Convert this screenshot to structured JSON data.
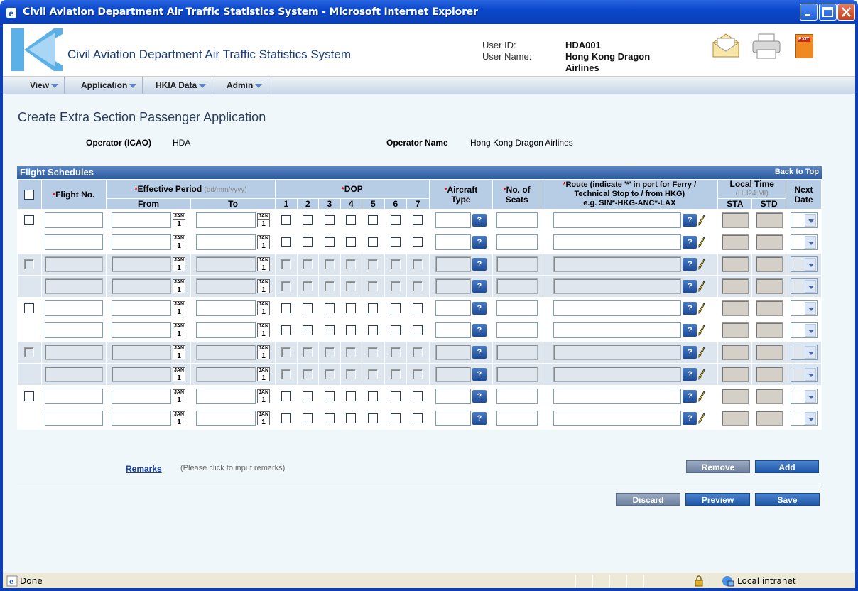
{
  "window": {
    "title": "Civil Aviation Department Air Traffic Statistics System - Microsoft Internet Explorer"
  },
  "header": {
    "app_name": "Civil Aviation Department Air Traffic Statistics System",
    "user_id_label": "User ID:",
    "user_id": "HDA001",
    "user_name_label": "User Name:",
    "user_name_line1": "Hong Kong Dragon",
    "user_name_line2": "Airlines",
    "exit_label": "EXIT"
  },
  "menu": [
    "View",
    "Application",
    "HKIA Data",
    "Admin"
  ],
  "page": {
    "title": "Create Extra Section Passenger Application",
    "operator_icao_label": "Operator (ICAO)",
    "operator_icao": "HDA",
    "operator_name_label": "Operator Name",
    "operator_name": "Hong Kong Dragon Airlines"
  },
  "grid": {
    "title": "Flight Schedules",
    "back_to_top": "Back to Top",
    "headers": {
      "required_mark": "*",
      "flight_no": "Flight No.",
      "effective_period": "Effective Period",
      "date_format": "(dd/mm/yyyy)",
      "from": "From",
      "to": "To",
      "dop": "DOP",
      "days": [
        "1",
        "2",
        "3",
        "4",
        "5",
        "6",
        "7"
      ],
      "aircraft_type_1": "Aircraft",
      "aircraft_type_2": "Type",
      "seats_1": "No. of",
      "seats_2": "Seats",
      "route_1": "Route (indicate '*' in port for Ferry /",
      "route_2": "Technical Stop to / from HKG)",
      "route_3": "e.g. SIN*-HKG-ANC*-LAX",
      "local_time": "Local Time",
      "time_format": "(HH24:MI)",
      "sta": "STA",
      "std": "STD",
      "next_1": "Next",
      "next_2": "Date"
    },
    "cal_month": "JAN",
    "cal_day": "1",
    "lookup_label": "?",
    "rows": [
      {
        "enabled": true,
        "first": true
      },
      {
        "enabled": true,
        "first": false
      },
      {
        "enabled": false,
        "first": true
      },
      {
        "enabled": false,
        "first": false
      },
      {
        "enabled": true,
        "first": true
      },
      {
        "enabled": true,
        "first": false
      },
      {
        "enabled": false,
        "first": true
      },
      {
        "enabled": false,
        "first": false
      },
      {
        "enabled": true,
        "first": true
      },
      {
        "enabled": true,
        "first": false
      }
    ]
  },
  "actions": {
    "remove": "Remove",
    "add": "Add",
    "remarks_link": "Remarks",
    "remarks_hint": "(Please click to input remarks)",
    "discard": "Discard",
    "preview": "Preview",
    "save": "Save"
  },
  "status": {
    "done": "Done",
    "zone": "Local intranet"
  },
  "colors": {
    "titlebar": "#0c3fb5",
    "grid_header": "#2c5aa0",
    "column_header": "#b7cde6",
    "button": "#1e58a8",
    "button_disabled": "#6d80a0"
  }
}
